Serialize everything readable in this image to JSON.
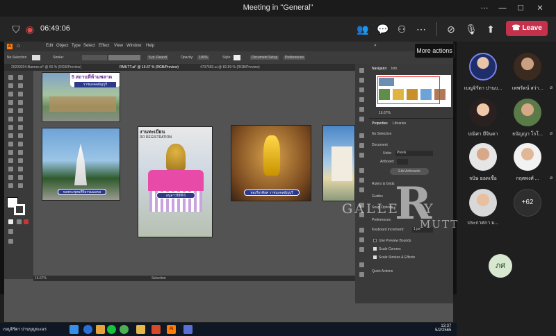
{
  "window": {
    "title": "Meeting in \"General\""
  },
  "meeting": {
    "timer": "06:49:06",
    "leave_label": "Leave",
    "tooltip": "More actions"
  },
  "illustrator": {
    "menu": [
      "Edit",
      "Object",
      "Type",
      "Select",
      "Effect",
      "View",
      "Window",
      "Help"
    ],
    "control": {
      "selection": "No Selection",
      "stroke_label": "Stroke:",
      "stroke_style": "5 pt. Round",
      "opacity_label": "Opacity:",
      "opacity_value": "100%",
      "style_label": "Style:",
      "doc_setup": "Document Setup",
      "preferences": "Preferences"
    },
    "tabs": [
      "20200204-Banner.ai* @ 50 % (RGB/Preview)",
      "RMUTT.ai* @ 16.67 % (RGB/Preview)",
      "4737583.ai @ 82.89 % (RGB/Preview)"
    ],
    "artboards": [
      {
        "caption": ""
      },
      {
        "caption": "หอพระพุทธศิริธรรมมงคล"
      },
      {
        "caption": "อนุสาวรีย์ที่ 6",
        "header": "งานทะเบียน",
        "subheader": "RO REGISTRATION"
      },
      {
        "caption": "หอเกียรติยศ ราชมงคลธัญบุรี"
      },
      {
        "caption": ""
      }
    ],
    "banner_text": "5 สถานที่ห้ามพลาด",
    "banner_sub": "ราชมงคลธัญบุรี",
    "navigator": {
      "tab1": "Navigator",
      "tab2": "Info",
      "zoom": "16.67%"
    },
    "properties": {
      "tab1": "Properties",
      "tab2": "Libraries",
      "no_selection": "No Selection",
      "document": "Document",
      "units_label": "Units:",
      "units_value": "Pixels",
      "artboard_label": "Artboard:",
      "edit_artboards": "Edit Artboards",
      "rulers_grids": "Rulers & Grids",
      "guides": "Guides",
      "snap": "Snap Options",
      "preferences": "Preferences",
      "keyboard": "Keyboard Increment:",
      "keyboard_value": "1 px",
      "opt1": "Use Preview Bounds",
      "opt2": "Scale Corners",
      "opt3": "Scale Strokes & Effects",
      "quick": "Quick Actions"
    },
    "status": {
      "zoom": "16.67%",
      "tool": "Selection"
    }
  },
  "taskbar": {
    "time": "13:37",
    "date": "5/2/2565",
    "presenter": "เบญจิรัตา ปานบุญยะเฉร"
  },
  "watermark": {
    "line1": "GALLE",
    "big": "R",
    "line2": "Y",
    "line3": "MUTT"
  },
  "participants": [
    {
      "name": "เบญจิรัตา ปานบ..."
    },
    {
      "name": "เทพรัตน์ สว่า..."
    },
    {
      "name": "ปณิศา มีจินดา"
    },
    {
      "name": "ธนัญญา โรโ..."
    },
    {
      "name": "จนิษ ยอดเชื้อ"
    },
    {
      "name": "กฤตพงศ์ ..."
    },
    {
      "name": "ประกาศกา ม..."
    }
  ],
  "more_count": "+62",
  "self_initials": "ภศ",
  "colors": {
    "leave": "#c4314b",
    "self_avatar": "#d8e8d0",
    "panel": "#3a3a3a",
    "canvas": "#535353"
  }
}
